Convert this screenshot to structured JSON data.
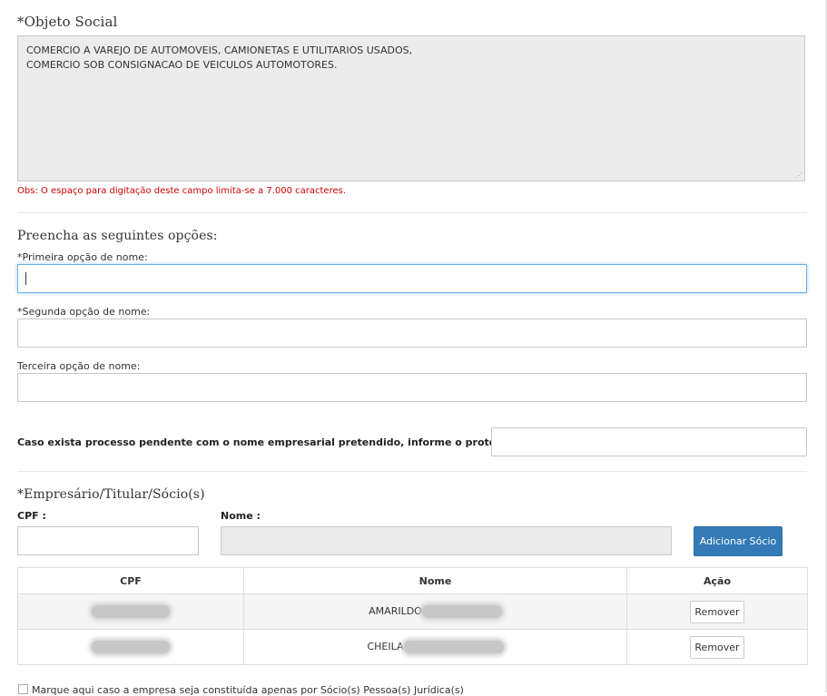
{
  "objeto_social": {
    "title": "*Objeto Social",
    "text": "COMERCIO A VAREJO DE AUTOMOVEIS, CAMIONETAS E UTILITARIOS USADOS,\nCOMERCIO SOB CONSIGNACAO DE VEICULOS AUTOMOTORES.",
    "note": "Obs: O espaço para digitação deste campo limita-se a 7.000 caracteres."
  },
  "nomes": {
    "title": "Preencha as seguintes opções:",
    "primeira_label": "*Primeira opção de nome:",
    "primeira_value": "",
    "segunda_label": "*Segunda opção de nome:",
    "segunda_value": "",
    "terceira_label": "Terceira opção de nome:",
    "terceira_value": ""
  },
  "protocolo": {
    "label": "Caso exista processo pendente com o nome empresarial pretendido, informe o protocolo:",
    "value": ""
  },
  "socios": {
    "title": "*Empresário/Titular/Sócio(s)",
    "cpf_label": "CPF :",
    "cpf_value": "",
    "nome_label": "Nome :",
    "nome_value": "",
    "add_button": "Adicionar Sócio",
    "table": {
      "headers": [
        "CPF",
        "Nome",
        "Ação"
      ],
      "rows": [
        {
          "cpf": "",
          "nome": "AMARILDO",
          "action": "Remover"
        },
        {
          "cpf": "",
          "nome": "CHEILA",
          "action": "Remover"
        }
      ]
    },
    "checkbox_label": "Marque aqui caso a empresa seja constituída apenas por Sócio(s) Pessoa(s) Jurídica(s)"
  },
  "colors": {
    "primary": "#337ab7",
    "note_red": "#cc0000",
    "focus": "#66afe9"
  }
}
